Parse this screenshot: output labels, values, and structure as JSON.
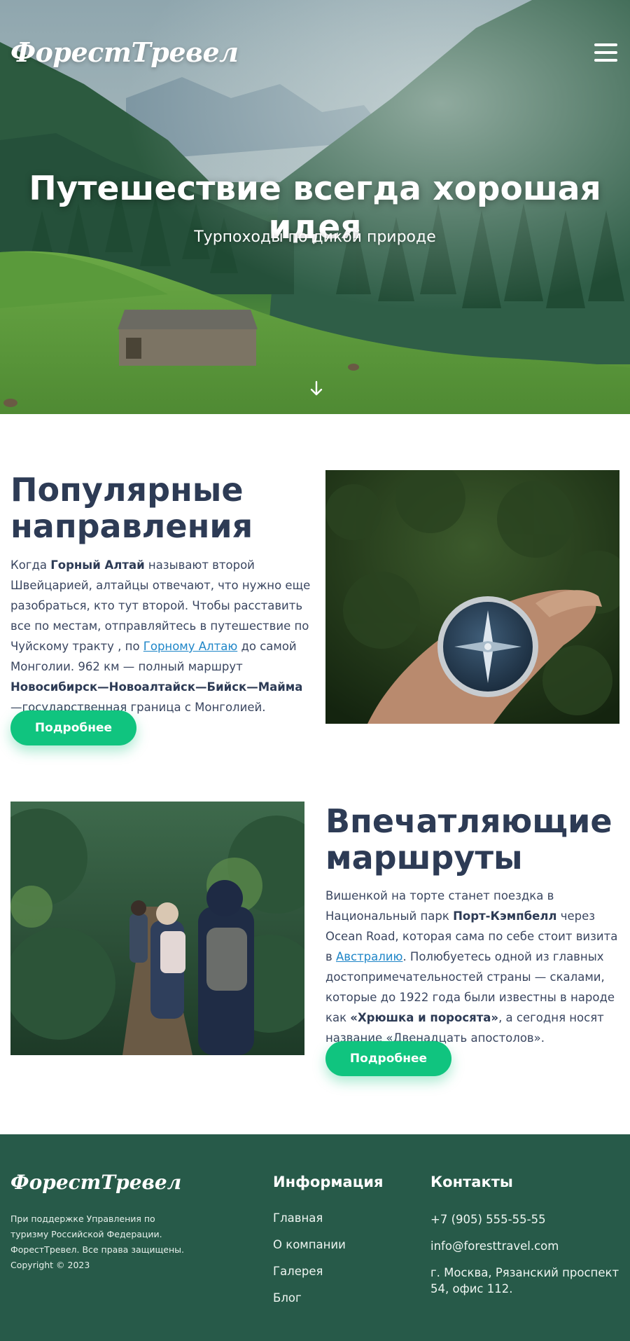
{
  "header": {
    "logo": "ФорестТревел",
    "menu_icon": "hamburger-menu-icon"
  },
  "hero": {
    "title": "Путешествие всегда хорошая идея",
    "subtitle": "Турпоходы по дикой природе",
    "scroll_icon": "arrow-down-icon"
  },
  "section1": {
    "title_line1": "Популярные",
    "title_line2": "направления",
    "text": {
      "p1": "Когда ",
      "b1": "Горный Алтай",
      "p2": " называют второй Швейцарией, алтайцы отвечают, что нужно еще разобраться, кто тут второй. Чтобы расставить все по местам, отправляйтесь в путешествие по Чуйскому тракту , по ",
      "link": "Горному Алтаю",
      "p3": " до самой Монголии. 962 км — полный маршрут ",
      "b2": "Новосибирск—Новоалтайск—Бийск—Майма",
      "p4": " —государственная граница с Монголией."
    },
    "button": "Подробнее",
    "image_icon": "compass-photo"
  },
  "section2": {
    "title_line1": "Впечатляющие",
    "title_line2": "маршруты",
    "text": {
      "p1": "Вишенкой на торте станет поездка в Национальный парк ",
      "b1": "Порт-Кэмпбелл",
      "p2": " через Ocean Road, которая сама по себе стоит визита в ",
      "link": "Австралию",
      "p3": ". Полюбуетесь одной из главных достопримечательностей страны — скалами, которые до 1922 года были известны в народе как ",
      "b2": "«Хрюшка и поросята»",
      "p4": ", а сегодня носят название «Двенадцать апостолов»."
    },
    "button": "Подробнее",
    "image_icon": "hikers-photo"
  },
  "footer": {
    "logo": "ФорестТревел",
    "note_line1": "При поддержке Управления по",
    "note_line2": "туризму Российской Федерации.",
    "note_line3": "ФорестТревел. Все права защищены.",
    "note_line4": "Copyright © 2023",
    "info_title": "Информация",
    "info_links": [
      "Главная",
      "О компании",
      "Галерея",
      "Блог"
    ],
    "contacts_title": "Контакты",
    "phone": "+7 (905) 555-55-55",
    "email": "info@foresttravel.com",
    "address": "г. Москва, Рязанский проспект 54, офис 112."
  },
  "colors": {
    "accent": "#10c47f",
    "heading": "#2d3b55",
    "footer_bg": "#275a49",
    "link": "#1f86c8"
  }
}
